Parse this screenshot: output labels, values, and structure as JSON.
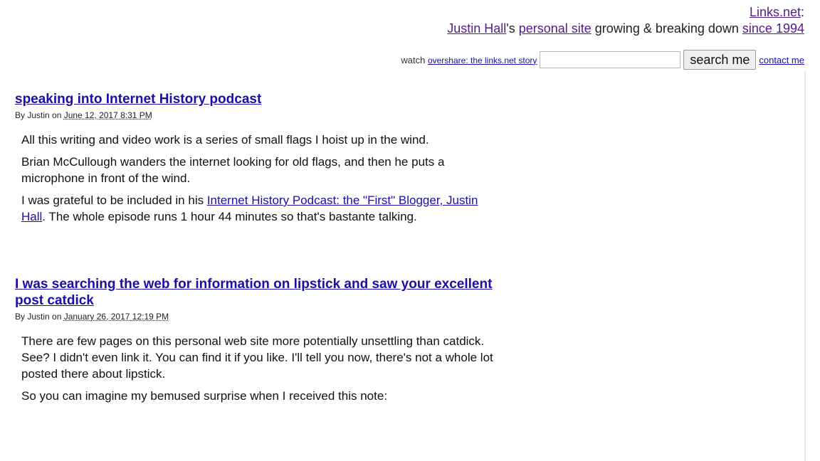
{
  "header": {
    "site_name": "Links.net",
    "colon": ":",
    "author_link": "Justin Hall",
    "possessive": "'s ",
    "personal_site_link": "personal site",
    "middle_text": " growing & breaking down ",
    "since_link": "since 1994"
  },
  "search": {
    "watch_label": "watch ",
    "overshare_link": "overshare: the links.net story",
    "input_value": "",
    "button_label": "search me",
    "contact_link": "contact me"
  },
  "posts": [
    {
      "title": "speaking into Internet History podcast",
      "by": "By Justin on ",
      "date": "June 12, 2017 8:31 PM",
      "p1": "All this writing and video work is a series of small flags I hoist up in the wind.",
      "p2": "Brian McCullough wanders the internet looking for old flags, and then he puts a microphone in front of the wind.",
      "p3_before": "I was grateful to be included in his ",
      "p3_link": "Internet History Podcast: the \"First\" Blogger, Justin Hall",
      "p3_after": ". The whole episode runs 1 hour 44 minutes so that's bastante talking."
    },
    {
      "title": "I was searching the web for information on lipstick and saw your excellent post catdick",
      "by": "By Justin on ",
      "date": "January 26, 2017 12:19 PM",
      "p1": "There are few pages on this personal web site more potentially unsettling than catdick. See? I didn't even link it. You can find it if you like. I'll tell you now, there's not a whole lot posted there about lipstick.",
      "p2": "So you can imagine my bemused surprise when I received this note:"
    }
  ]
}
